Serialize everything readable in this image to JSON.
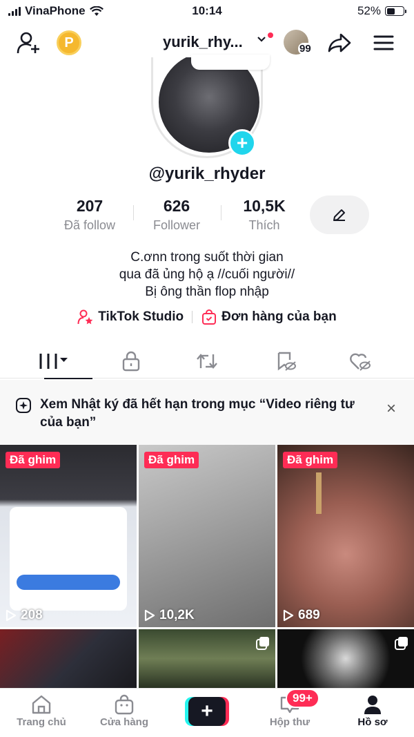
{
  "status_bar": {
    "carrier": "VinaPhone",
    "time": "10:14",
    "battery": "52%",
    "battery_level": 0.52
  },
  "top_nav": {
    "username": "yurik_rhy...",
    "friend_badge": "99"
  },
  "profile": {
    "handle": "@yurik_rhyder",
    "stats": [
      {
        "value": "207",
        "label": "Đã follow"
      },
      {
        "value": "626",
        "label": "Follower"
      },
      {
        "value": "10,5K",
        "label": "Thích"
      }
    ],
    "bio": [
      "C.ơnn trong suốt thời gian",
      "qua đã ủng hộ ạ //cuối người//",
      "Bị ông thần flop nhập"
    ],
    "links": {
      "studio": "TikTok Studio",
      "orders": "Đơn hàng của bạn"
    }
  },
  "notice": {
    "text": "Xem Nhật ký đã hết hạn trong mục “Video riêng tư của bạn”",
    "close": "×"
  },
  "videos": [
    {
      "pinned": "Đã ghim",
      "views": "208"
    },
    {
      "pinned": "Đã ghim",
      "views": "10,2K"
    },
    {
      "pinned": "Đã ghim",
      "views": "689"
    }
  ],
  "bottom_nav": {
    "home": "Trang chủ",
    "shop": "Cửa hàng",
    "create": "+",
    "inbox": "Hộp thư",
    "inbox_badge": "99+",
    "profile": "Hồ sơ"
  },
  "colors": {
    "accent": "#fe2c55",
    "cyan": "#25f4ee",
    "coin": "#f5b82e"
  }
}
